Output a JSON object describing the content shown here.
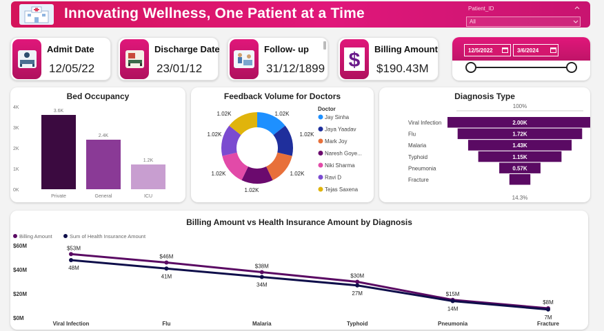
{
  "header": {
    "title": "Innovating Wellness, One Patient at a Time",
    "slicer_label": "Patient_ID",
    "slicer_value": "All"
  },
  "kpis": [
    {
      "label": "Admit Date",
      "value": "12/05/22",
      "icon": "hospital-bed-icon"
    },
    {
      "label": "Discharge Date",
      "value": "23/01/12",
      "icon": "bed-discharge-icon"
    },
    {
      "label": "Follow- up",
      "value": "31/12/1899",
      "icon": "reception-icon"
    },
    {
      "label": "Billing Amount",
      "value": "$190.43M",
      "icon": "dollar-icon"
    }
  ],
  "date_filter": {
    "start": "12/5/2022",
    "end": "3/6/2024"
  },
  "bed_occupancy": {
    "title": "Bed Occupancy",
    "chart_data": {
      "type": "bar",
      "categories": [
        "Private",
        "General",
        "ICU"
      ],
      "values": [
        3600,
        2400,
        1200
      ],
      "value_labels": [
        "3.6K",
        "2.4K",
        "1.2K"
      ],
      "yticks": [
        "0K",
        "1K",
        "2K",
        "3K",
        "4K"
      ],
      "ylim": [
        0,
        4000
      ],
      "colors": [
        "#3b0a40",
        "#8a3a96",
        "#c89ed0"
      ]
    }
  },
  "feedback": {
    "title": "Feedback Volume for Doctors",
    "legend_title": "Doctor",
    "chart_data": {
      "type": "pie",
      "labels": [
        "Jay Sinha",
        "Jaya Yaadav",
        "Mark Joy",
        "Naresh Goye...",
        "Niki Sharma",
        "Ravi D",
        "Tejas Saxena"
      ],
      "values": [
        1020,
        1020,
        1020,
        1020,
        1020,
        1020,
        1020
      ],
      "value_labels": [
        "1.02K",
        "1.02K",
        "1.02K",
        "1.02K",
        "1.02K",
        "1.02K",
        "1.02K"
      ],
      "colors": [
        "#1e90ff",
        "#1f2f9c",
        "#e8703a",
        "#6b0a6e",
        "#e24aa8",
        "#7b4bd0",
        "#e0b40c"
      ]
    }
  },
  "diagnosis": {
    "title": "Diagnosis Type",
    "top_pct": "100%",
    "bottom_pct": "14.3%",
    "chart_data": {
      "type": "bar",
      "categories": [
        "Viral Infection",
        "Flu",
        "Malaria",
        "Typhoid",
        "Pneumonia",
        "Fracture"
      ],
      "values": [
        2000,
        1720,
        1430,
        1150,
        570,
        290
      ],
      "value_labels": [
        "2.00K",
        "1.72K",
        "1.43K",
        "1.15K",
        "0.57K",
        ""
      ],
      "color": "#5a0a63"
    }
  },
  "billing": {
    "title": "Billing Amount vs Health Insurance Amount by Diagnosis",
    "chart_data": {
      "type": "line",
      "categories": [
        "Viral Infection",
        "Flu",
        "Malaria",
        "Typhoid",
        "Pneumonia",
        "Fracture"
      ],
      "yticks": [
        "$0M",
        "$20M",
        "$40M",
        "$60M"
      ],
      "ylim": [
        0,
        60
      ],
      "series": [
        {
          "name": "Billing Amount",
          "values": [
            53,
            46,
            38,
            30,
            15,
            8
          ],
          "labels": [
            "$53M",
            "$46M",
            "$38M",
            "$30M",
            "$15M",
            "$8M"
          ],
          "color": "#5a0a63"
        },
        {
          "name": "Sum of Health Insurance Amount",
          "values": [
            48,
            41,
            34,
            27,
            14,
            7
          ],
          "labels": [
            "48M",
            "41M",
            "34M",
            "27M",
            "14M",
            "7M"
          ],
          "color": "#0e0e4a"
        }
      ]
    }
  }
}
